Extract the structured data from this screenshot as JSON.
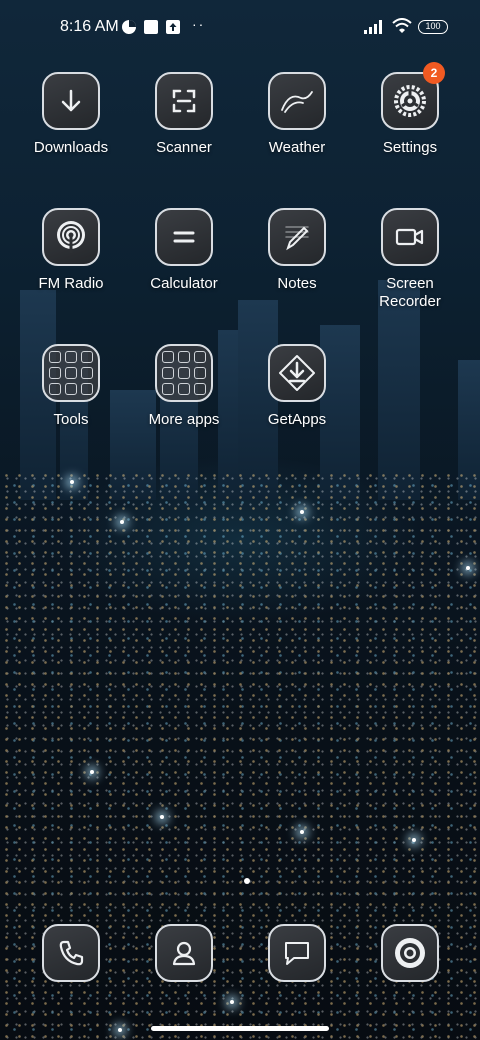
{
  "status_bar": {
    "time": "8:16 AM",
    "notification_icons": [
      "data-saver-icon",
      "square-icon",
      "upload-icon"
    ],
    "more": "··",
    "battery": "100"
  },
  "apps": [
    {
      "label": "Downloads",
      "icon": "download-arrow-icon"
    },
    {
      "label": "Scanner",
      "icon": "scanner-frame-icon"
    },
    {
      "label": "Weather",
      "icon": "weather-curve-icon"
    },
    {
      "label": "Settings",
      "icon": "gear-icon",
      "badge": "2"
    },
    {
      "label": "FM Radio",
      "icon": "radio-icon"
    },
    {
      "label": "Calculator",
      "icon": "equals-icon"
    },
    {
      "label": "Notes",
      "icon": "pencil-notes-icon"
    },
    {
      "label": "Screen Recorder",
      "icon": "video-camera-icon"
    },
    {
      "label": "Tools",
      "icon": "folder-icon"
    },
    {
      "label": "More apps",
      "icon": "folder-icon"
    },
    {
      "label": "GetApps",
      "icon": "getapps-icon"
    }
  ],
  "dock": [
    {
      "name": "Phone",
      "icon": "phone-icon"
    },
    {
      "name": "Contacts",
      "icon": "contact-icon"
    },
    {
      "name": "Messages",
      "icon": "message-icon"
    },
    {
      "name": "Camera",
      "icon": "camera-lens-icon"
    }
  ]
}
